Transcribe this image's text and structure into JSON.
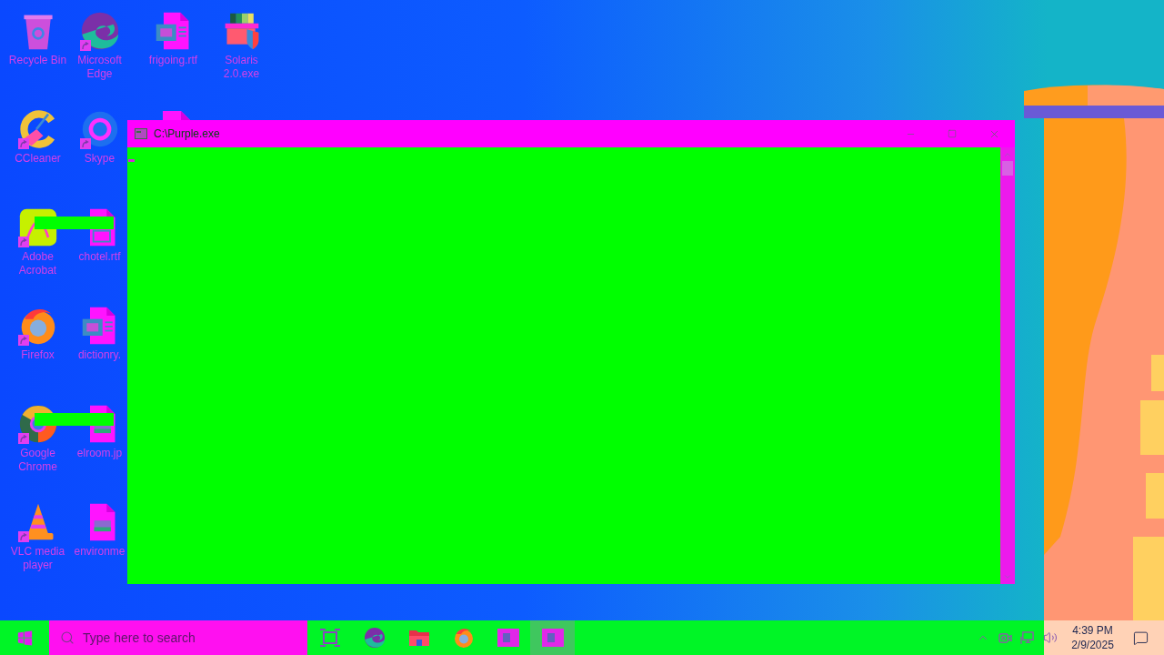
{
  "desktop": {
    "columns": [
      {
        "icons": [
          {
            "label": "Recycle Bin",
            "kind": "recycle-bin",
            "shortcut": false,
            "overlay_bar": false
          },
          {
            "label": "CCleaner",
            "kind": "ccleaner",
            "shortcut": true,
            "overlay_bar": false
          },
          {
            "label": "Adobe Acrobat",
            "kind": "acrobat",
            "shortcut": true,
            "overlay_bar": true
          },
          {
            "label": "Firefox",
            "kind": "firefox",
            "shortcut": true,
            "overlay_bar": false
          },
          {
            "label": "Google Chrome",
            "kind": "chrome",
            "shortcut": true,
            "overlay_bar": true
          },
          {
            "label": "VLC media player",
            "kind": "vlc",
            "shortcut": true,
            "overlay_bar": false
          }
        ]
      },
      {
        "icons": [
          {
            "label": "Microsoft Edge",
            "kind": "edge",
            "shortcut": true,
            "overlay_bar": false
          },
          {
            "label": "Skype",
            "kind": "skype",
            "shortcut": true,
            "overlay_bar": false
          },
          {
            "label": "chotel.rtf",
            "kind": "image-doc",
            "shortcut": false,
            "overlay_bar": false
          },
          {
            "label": "dictionry.",
            "kind": "word-doc",
            "shortcut": false,
            "overlay_bar": false
          },
          {
            "label": "elroom.jp",
            "kind": "image-file",
            "shortcut": false,
            "overlay_bar": false
          },
          {
            "label": "environme",
            "kind": "image-file",
            "shortcut": false,
            "overlay_bar": false
          }
        ]
      },
      {
        "icons": [
          {
            "label": "frigoing.rtf",
            "kind": "word-doc",
            "shortcut": false,
            "overlay_bar": false
          },
          {
            "kind": "covered-file",
            "shortcut": false,
            "overlay_bar": false
          }
        ]
      },
      {
        "icons": [
          {
            "label": "Solaris 2.0.exe",
            "kind": "installer",
            "shortcut": false,
            "overlay_bar": false
          }
        ]
      }
    ]
  },
  "window": {
    "title": "C:\\Purple.exe"
  },
  "taskbar": {
    "search": {
      "placeholder": "Type here to search"
    },
    "apps": [
      {
        "kind": "task-view",
        "active": false
      },
      {
        "kind": "edge",
        "active": false
      },
      {
        "kind": "folder",
        "active": false
      },
      {
        "kind": "firefox",
        "active": false
      },
      {
        "kind": "app",
        "active": false
      },
      {
        "kind": "app",
        "active": true
      }
    ],
    "clock": {
      "time": "4:39 PM",
      "date": "2/9/2025"
    }
  }
}
